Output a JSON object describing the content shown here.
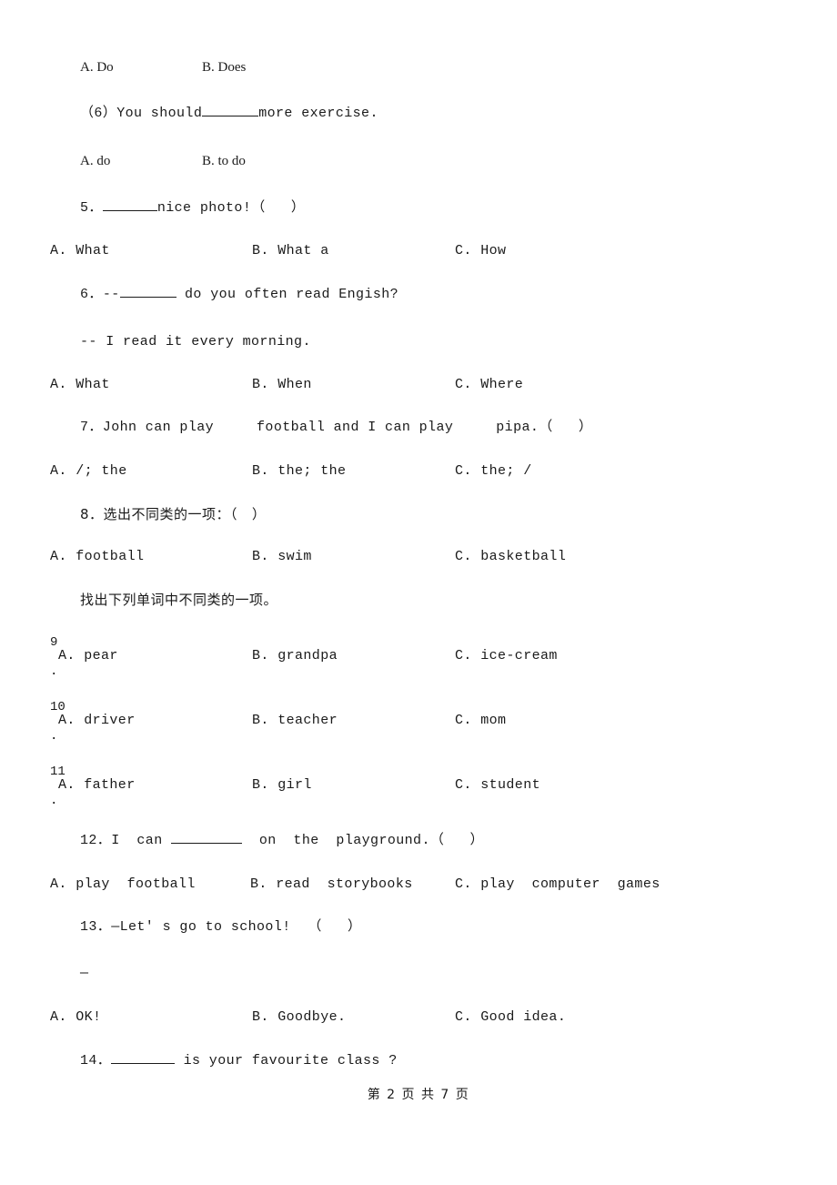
{
  "document": {
    "type": "exam-paper",
    "language": "en-zh",
    "footer": "第 2 页 共 7 页",
    "page_number": "2",
    "total_pages": "7"
  },
  "blocks": {
    "q4_options": {
      "a": "A. Do",
      "b": "B. Does"
    },
    "q6_sub": {
      "stem_pre": "（6）You should",
      "stem_post": "more exercise.",
      "a": "A. do",
      "b": "B. to do"
    },
    "q5": {
      "num": "5．",
      "stem_post": "nice photo!（   ）",
      "a": "A. What",
      "b": "B. What a",
      "c": "C. How"
    },
    "q6": {
      "num": "6．",
      "stem_pre": "--",
      "stem_post": " do you often read Engish?",
      "answer_line": "-- I read it every morning.",
      "a": "A. What",
      "b": "B. When",
      "c": "C. Where"
    },
    "q7": {
      "stem": "7．John can play     football and I can play     pipa.（   ）",
      "a": "A. /; the",
      "b": "B. the; the",
      "c": "C. the; /"
    },
    "q8": {
      "stem": "8．选出不同类的一项：（   ）",
      "a": "A. football",
      "b": "B. swim",
      "c": "C. basketball"
    },
    "instruction": "找出下列单词中不同类的一项。",
    "q9": {
      "num": "9",
      "dot": ".",
      "a": "A. pear",
      "b": "B. grandpa",
      "c": "C. ice-cream"
    },
    "q10": {
      "num": "10",
      "dot": ".",
      "a": "A. driver",
      "b": "B. teacher",
      "c": "C. mom"
    },
    "q11": {
      "num": "11",
      "dot": ".",
      "a": "A. father",
      "b": "B. girl",
      "c": "C. student"
    },
    "q12": {
      "num": "12．I  can ",
      "stem_post": "  on  the  playground.（   ）",
      "a": "A. play  football",
      "b": "B. read  storybooks",
      "c": "C. play  computer  games"
    },
    "q13": {
      "stem": "13．—Let' s go to school!  （   ）",
      "dash": "—",
      "a": "A. OK!",
      "b": "B. Goodbye.",
      "c": "C. Good idea."
    },
    "q14": {
      "num": "14．",
      "stem_post": " is your favourite class ?"
    }
  }
}
